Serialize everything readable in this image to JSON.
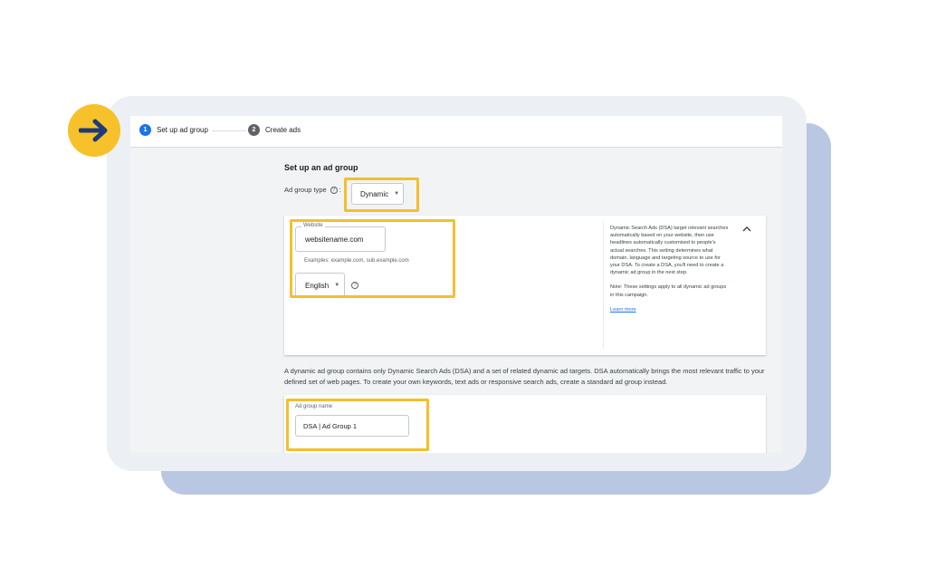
{
  "stepper": {
    "step1": {
      "num": "1",
      "label": "Set up ad group"
    },
    "step2": {
      "num": "2",
      "label": "Create ads"
    }
  },
  "section_title": "Set up an ad group",
  "ad_group_type": {
    "label": "Ad group type",
    "value": "Dynamic"
  },
  "website": {
    "label": "Website",
    "value": "websitename.com",
    "examples": "Examples: example.com, sub.example.com"
  },
  "language": {
    "value": "English"
  },
  "help_panel": {
    "paragraph1": "Dynamic Search Ads (DSA) target relevant searches automatically based on your website, then use headlines automatically customised to people's actual searches. This setting determines what domain, language and targeting source to use for your DSA. To create a DSA, you'll need to create a dynamic ad group in the next step.",
    "paragraph2": "Note: These settings apply to all dynamic ad groups in this campaign.",
    "learn_more": "Learn more"
  },
  "description": "A dynamic ad group contains only Dynamic Search Ads (DSA) and a set of related dynamic ad targets. DSA automatically brings the most relevant traffic to your defined set of web pages. To create your own keywords, text ads or responsive search ads, create a standard ad group instead.",
  "ad_group_name": {
    "label": "Ad group name",
    "value": "DSA | Ad Group 1"
  },
  "colors": {
    "highlight": "#f4bf2b",
    "arrow_badge": "#f6c12a",
    "arrow": "#1f3a78",
    "active_step": "#1a73e8",
    "inactive_step": "#5f6368",
    "back_card": "#b9c7e2"
  },
  "icons": [
    "arrow-right-icon",
    "help-circle-icon",
    "chevron-up-icon",
    "dropdown-caret-icon"
  ]
}
